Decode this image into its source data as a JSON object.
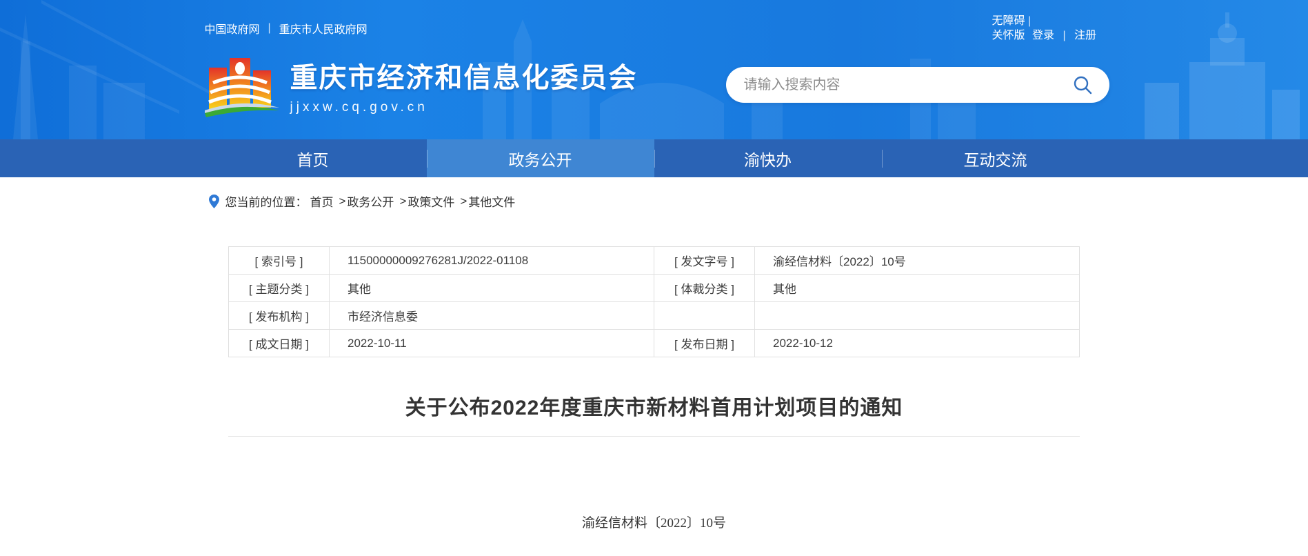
{
  "header": {
    "top_links_left": {
      "gov_cn": "中国政府网",
      "cq_gov": "重庆市人民政府网"
    },
    "divider": "|",
    "top_links_right": {
      "accessibility": "无障碍",
      "care_version": "关怀版",
      "login": "登录",
      "register": "注册"
    },
    "site_name": "重庆市经济和信息化委员会",
    "site_url": "jjxxw.cq.gov.cn",
    "search": {
      "placeholder": "请输入搜索内容"
    }
  },
  "nav": {
    "tabs": [
      {
        "label": "首页",
        "active": false
      },
      {
        "label": "政务公开",
        "active": true
      },
      {
        "label": "渝快办",
        "active": false
      },
      {
        "label": "互动交流",
        "active": false
      }
    ]
  },
  "breadcrumb": {
    "prefix": "您当前的位置：",
    "separator": ">",
    "items": [
      "首页",
      "政务公开",
      "政策文件",
      "其他文件"
    ]
  },
  "doc_meta": {
    "rows": [
      {
        "label1": "[ 索引号 ]",
        "value1": "11500000009276281J/2022-01108",
        "label2": "[ 发文字号 ]",
        "value2": "渝经信材料〔2022〕10号"
      },
      {
        "label1": "[ 主题分类 ]",
        "value1": "其他",
        "label2": "[ 体裁分类 ]",
        "value2": "其他"
      },
      {
        "label1": "[ 发布机构 ]",
        "value1": "市经济信息委",
        "label2": "",
        "value2": ""
      },
      {
        "label1": "[ 成文日期 ]",
        "value1": "2022-10-11",
        "label2": "[ 发布日期 ]",
        "value2": "2022-10-12"
      }
    ]
  },
  "article": {
    "title": "关于公布2022年度重庆市新材料首用计划项目的通知",
    "doc_number": "渝经信材料〔2022〕10号"
  },
  "colors": {
    "header_blue": "#1b82e6",
    "nav_blue": "#2a63b5",
    "nav_active_blue": "#3f86d3",
    "search_icon_blue": "#3170c0",
    "pin_blue": "#2f7ad6",
    "text_dark": "#333333",
    "table_border": "#e0e0e0"
  }
}
